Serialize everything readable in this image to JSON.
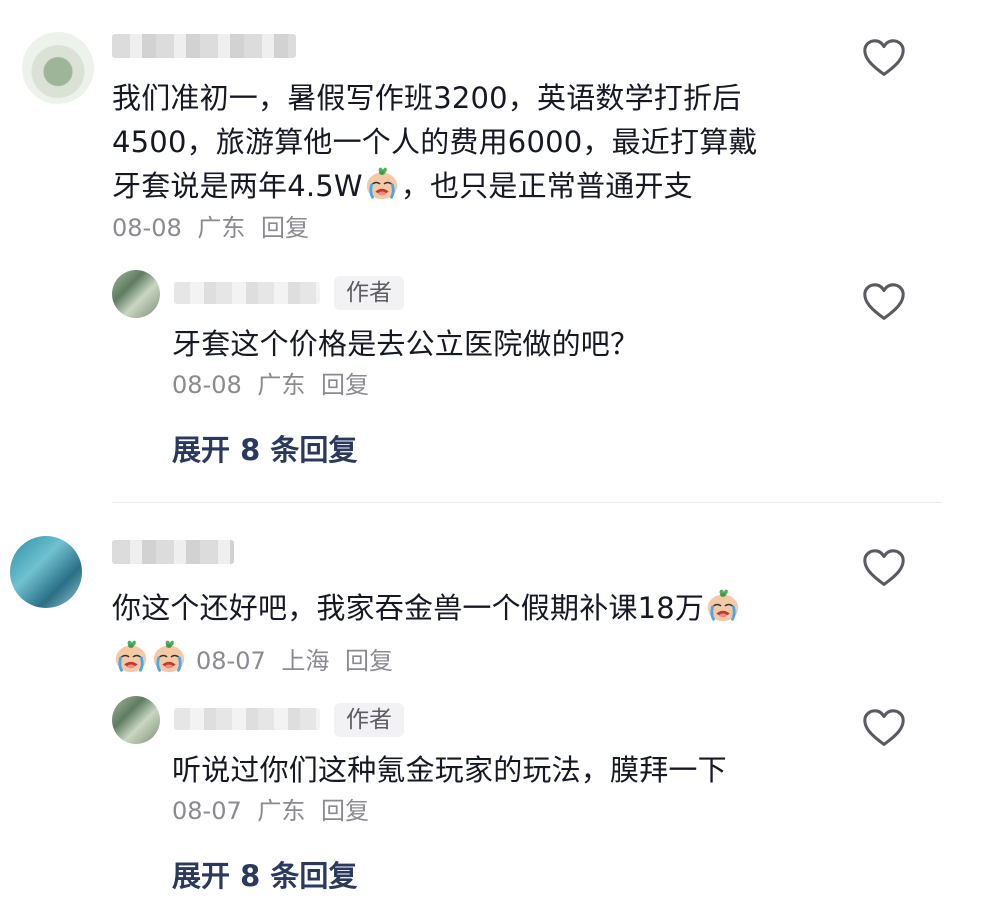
{
  "comments": [
    {
      "text_line1": "我们准初一，暑假写作班3200，英语数学打折后",
      "text_line2": "4500，旅游算他一个人的费用6000，最近打算戴",
      "text_line3_a": "牙套说是两年4.5W",
      "text_line3_b": "，也只是正常普通开支",
      "date": "08-08",
      "location": "广东",
      "reply_label": "回复",
      "avatar_icon": "blurred-avatar",
      "reply": {
        "author_tag": "作者",
        "text": "牙套这个价格是去公立医院做的吧？",
        "date": "08-08",
        "location": "广东",
        "reply_label": "回复"
      },
      "expand_label": "展开 8 条回复"
    },
    {
      "text_line1_a": "你这个还好吧，我家吞金兽一个假期补课18万",
      "date": "08-07",
      "location": "上海",
      "reply_label": "回复",
      "avatar_icon": "blurred-avatar",
      "reply": {
        "author_tag": "作者",
        "text": "听说过你们这种氪金玩家的玩法，膜拜一下",
        "date": "08-07",
        "location": "广东",
        "reply_label": "回复"
      },
      "expand_label": "展开 8 条回复"
    }
  ],
  "icons": {
    "like": "heart-outline-icon",
    "emoji": "crying-emoji-icon"
  },
  "colors": {
    "text": "#161823",
    "meta": "#8a8b91",
    "expand": "#2b3a5c",
    "author_tag_bg": "#f2f2f4"
  }
}
